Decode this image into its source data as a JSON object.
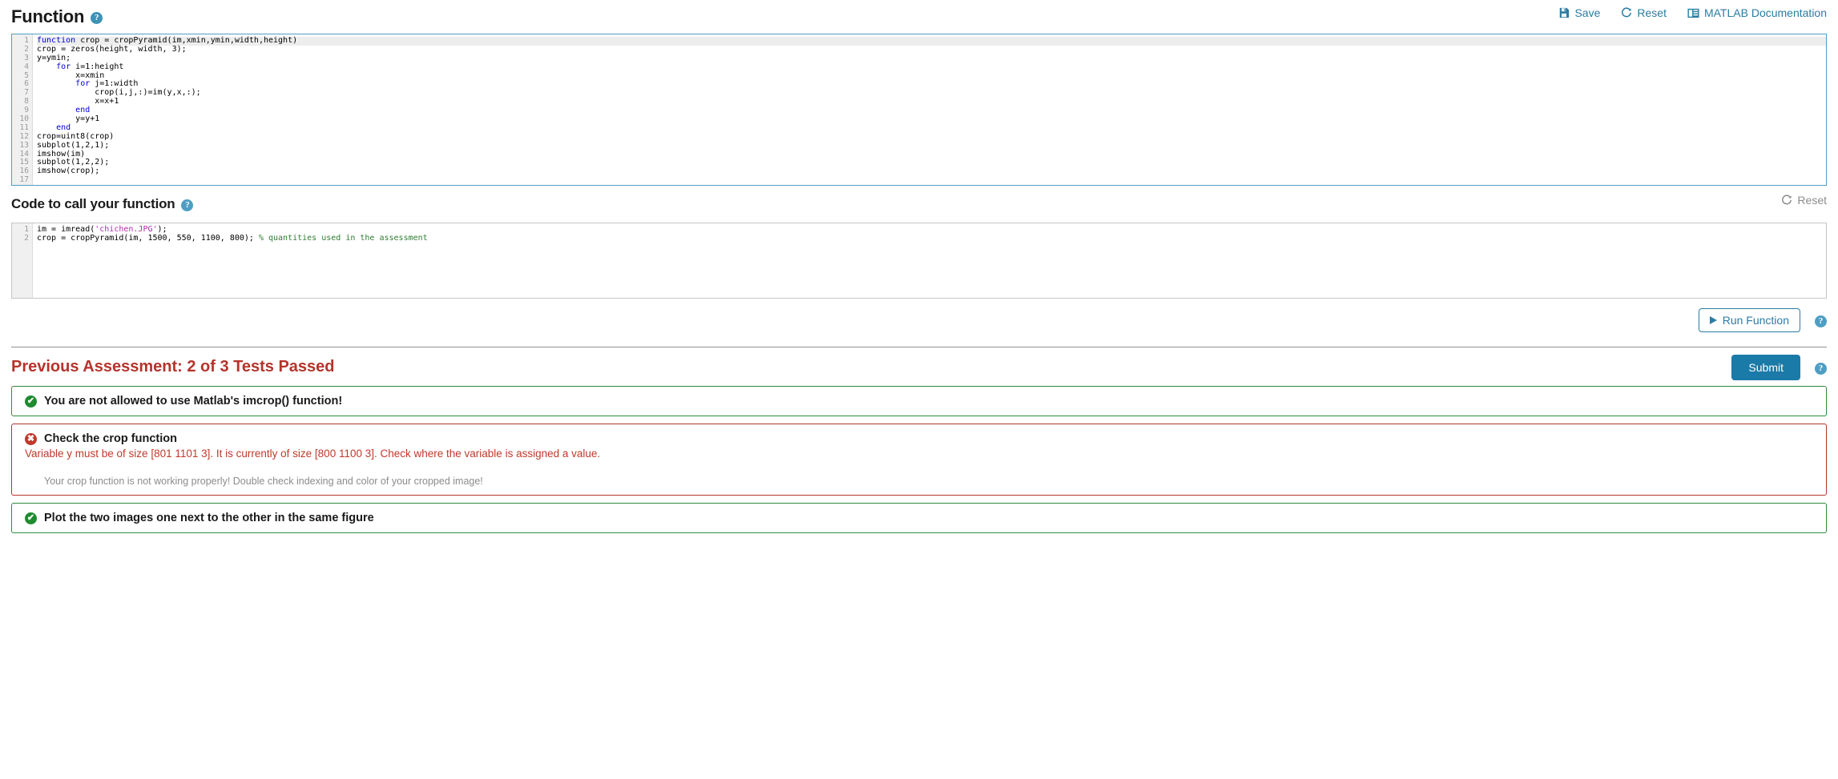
{
  "function_section": {
    "title": "Function",
    "help_icon": "help-circle-icon",
    "toolbar": [
      {
        "label": "Save",
        "icon": "save-disk-icon",
        "style": "link"
      },
      {
        "label": "Reset",
        "icon": "reset-refresh-icon",
        "style": "link"
      },
      {
        "label": "MATLAB Documentation",
        "icon": "documentation-book-icon",
        "style": "link"
      }
    ],
    "editor": {
      "total_lines": 17,
      "active_line": 1,
      "lines": [
        {
          "n": 1,
          "tokens": [
            {
              "t": "function",
              "c": "kw"
            },
            {
              "t": " crop = cropPyramid(im,xmin,ymin,width,height)",
              "c": ""
            }
          ]
        },
        {
          "n": 2,
          "tokens": [
            {
              "t": "crop = zeros(height, width, 3);",
              "c": ""
            }
          ]
        },
        {
          "n": 3,
          "tokens": [
            {
              "t": "y=ymin;",
              "c": ""
            }
          ]
        },
        {
          "n": 4,
          "tokens": [
            {
              "t": "    ",
              "c": ""
            },
            {
              "t": "for",
              "c": "kw"
            },
            {
              "t": " i=1:height",
              "c": ""
            }
          ]
        },
        {
          "n": 5,
          "tokens": [
            {
              "t": "        x=xmin",
              "c": ""
            }
          ]
        },
        {
          "n": 6,
          "tokens": [
            {
              "t": "        ",
              "c": ""
            },
            {
              "t": "for",
              "c": "kw"
            },
            {
              "t": " j=1:width",
              "c": ""
            }
          ]
        },
        {
          "n": 7,
          "tokens": [
            {
              "t": "            crop(i,j,:)=im(y,x,:);",
              "c": ""
            }
          ]
        },
        {
          "n": 8,
          "tokens": [
            {
              "t": "            x=x+1",
              "c": ""
            }
          ]
        },
        {
          "n": 9,
          "tokens": [
            {
              "t": "        ",
              "c": ""
            },
            {
              "t": "end",
              "c": "kw"
            }
          ]
        },
        {
          "n": 10,
          "tokens": [
            {
              "t": "        y=y+1",
              "c": ""
            }
          ]
        },
        {
          "n": 11,
          "tokens": [
            {
              "t": "    ",
              "c": ""
            },
            {
              "t": "end",
              "c": "kw"
            }
          ]
        },
        {
          "n": 12,
          "tokens": [
            {
              "t": "crop=uint8(crop)",
              "c": ""
            }
          ]
        },
        {
          "n": 13,
          "tokens": [
            {
              "t": "subplot(1,2,1);",
              "c": ""
            }
          ]
        },
        {
          "n": 14,
          "tokens": [
            {
              "t": "imshow(im)",
              "c": ""
            }
          ]
        },
        {
          "n": 15,
          "tokens": [
            {
              "t": "subplot(1,2,2);",
              "c": ""
            }
          ]
        },
        {
          "n": 16,
          "tokens": [
            {
              "t": "imshow(crop);",
              "c": ""
            }
          ]
        },
        {
          "n": 17,
          "tokens": [
            {
              "t": "",
              "c": ""
            }
          ]
        }
      ]
    }
  },
  "call_section": {
    "title": "Code to call your function",
    "help_icon": "help-circle-icon",
    "reset": {
      "label": "Reset",
      "icon": "reset-refresh-icon"
    },
    "editor": {
      "total_lines": 2,
      "blank_rows": 8,
      "lines": [
        {
          "n": 1,
          "tokens": [
            {
              "t": "im = imread(",
              "c": ""
            },
            {
              "t": "'chichen.JPG'",
              "c": "str"
            },
            {
              "t": ");",
              "c": ""
            }
          ]
        },
        {
          "n": 2,
          "tokens": [
            {
              "t": "crop = cropPyramid(im, 1500, 550, 1100, 800); ",
              "c": ""
            },
            {
              "t": "% quantities used in the assessment",
              "c": "cmt"
            }
          ]
        }
      ]
    }
  },
  "run_bar": {
    "run_label": "Run Function",
    "run_icon": "play-triangle-icon",
    "help_icon": "help-circle-icon"
  },
  "assessment": {
    "title": "Previous Assessment: 2 of 3 Tests Passed",
    "submit_label": "Submit",
    "help_icon": "help-circle-icon",
    "results": [
      {
        "status": "pass",
        "badge_glyph": "✔",
        "title": "You are not allowed to use Matlab's imcrop() function!",
        "message": "",
        "subtext": ""
      },
      {
        "status": "fail",
        "badge_glyph": "✖",
        "title": "Check the crop function",
        "message": "Variable y must be of size [801 1101 3]. It is currently of size [800 1100 3]. Check where the variable is assigned a value.",
        "subtext": "Your crop function is not working properly! Double check indexing and color of your cropped image!"
      },
      {
        "status": "pass",
        "badge_glyph": "✔",
        "title": "Plot the two images one next to the other in the same figure",
        "message": "",
        "subtext": ""
      }
    ]
  },
  "colors": {
    "accent": "#2b7ca3",
    "primary_button": "#1a7aa8",
    "pass": "#1e8b2f",
    "fail": "#c0392b",
    "assess_title": "#b5342b",
    "editor_focus_border": "#4e9ec4",
    "editor_border": "#c6c6c6",
    "gutter_bg": "#f0f0f0",
    "comment": "#2e7d32",
    "string": "#b02ab0",
    "keyword": "#0000d0"
  }
}
